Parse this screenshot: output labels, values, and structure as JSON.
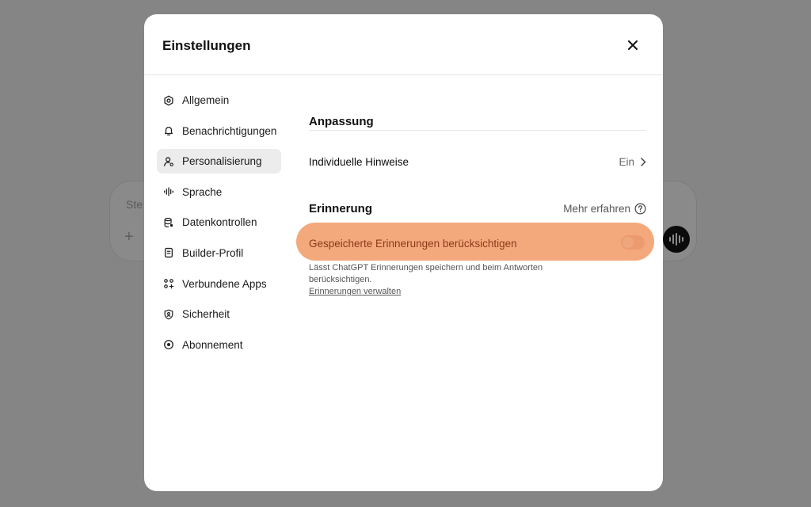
{
  "background": {
    "composer_placeholder": "Ste"
  },
  "modal": {
    "title": "Einstellungen"
  },
  "sidebar": {
    "items": [
      {
        "label": "Allgemein",
        "icon": "gear-icon"
      },
      {
        "label": "Benachrichtigungen",
        "icon": "bell-icon"
      },
      {
        "label": "Personalisierung",
        "icon": "person-icon",
        "active": true
      },
      {
        "label": "Sprache",
        "icon": "waveform-icon"
      },
      {
        "label": "Datenkontrollen",
        "icon": "database-icon"
      },
      {
        "label": "Builder-Profil",
        "icon": "id-card-icon"
      },
      {
        "label": "Verbundene Apps",
        "icon": "apps-grid-icon"
      },
      {
        "label": "Sicherheit",
        "icon": "shield-icon"
      },
      {
        "label": "Abonnement",
        "icon": "subscription-icon"
      }
    ]
  },
  "content": {
    "section1_title": "Anpassung",
    "custom_instructions_label": "Individuelle Hinweise",
    "custom_instructions_value": "Ein",
    "section2_title": "Erinnerung",
    "learn_more": "Mehr erfahren",
    "memory_toggle_label": "Gespeicherte Erinnerungen berücksichtigen",
    "memory_toggle_on": false,
    "memory_description": "Lässt ChatGPT Erinnerungen speichern und beim Antworten berücksichtigen.",
    "manage_memories_link": "Erinnerungen verwalten"
  },
  "colors": {
    "highlight": "#f4a97d",
    "overlay": "#858585"
  }
}
